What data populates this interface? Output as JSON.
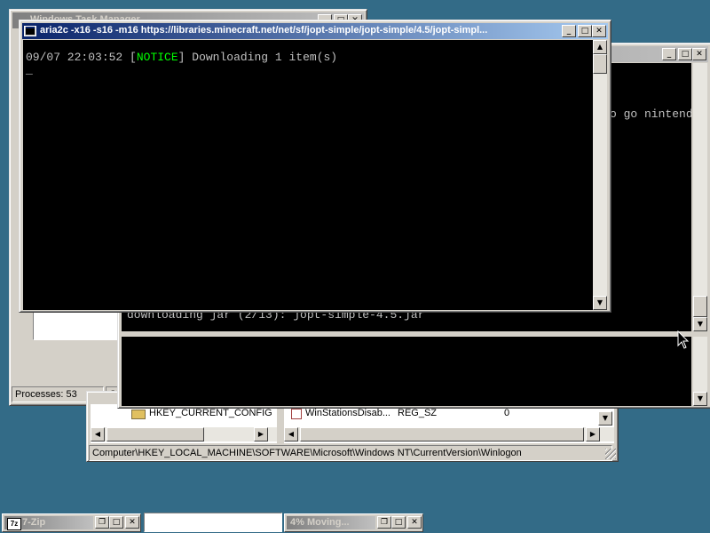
{
  "task_manager": {
    "title": "Windows Task Manager",
    "status_processes": "Processes: 53",
    "status_cpu": "CP"
  },
  "registry": {
    "tree_item": "HKEY_CURRENT_CONFIG",
    "value_name": "WinStationsDisab...",
    "value_type": "REG_SZ",
    "value_data": "0",
    "statusbar": "Computer\\HKEY_LOCAL_MACHINE\\SOFTWARE\\Microsoft\\Windows NT\\CurrentVersion\\Winlogon"
  },
  "bg_console": {
    "line_partial": "o go nintend",
    "line_download": "downloading jar (2/13): jopt-simple-4.5.jar"
  },
  "aria": {
    "title": "aria2c  -x16 -s16 -m16 https://libraries.minecraft.net/net/sf/jopt-simple/jopt-simple/4.5/jopt-simpl...",
    "line_time": "09/07 22:03:52 ",
    "line_open": "[",
    "line_notice": "NOTICE",
    "line_close": "]",
    "line_rest": " Downloading 1 item(s)",
    "cursor": "_"
  },
  "taskbar": {
    "item1": "7-Zip",
    "item3": "4% Moving..."
  },
  "colors": {
    "desktop": "#336b87",
    "notice": "#00ff00",
    "active_title": "#0a246a"
  }
}
